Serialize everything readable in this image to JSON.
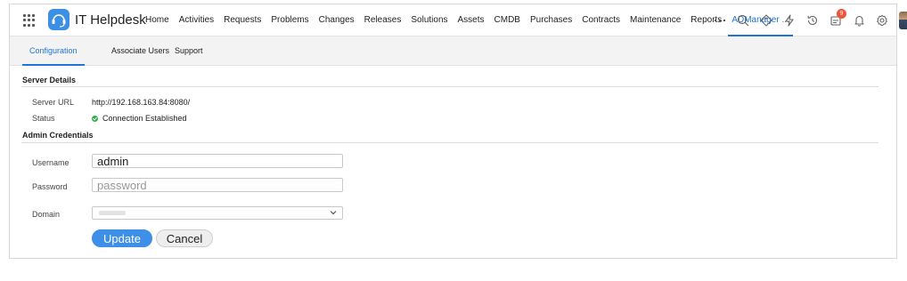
{
  "app": {
    "title": "IT Helpdesk"
  },
  "nav": {
    "items": [
      "Home",
      "Activities",
      "Requests",
      "Problems",
      "Changes",
      "Releases",
      "Solutions",
      "Assets",
      "CMDB",
      "Purchases",
      "Contracts",
      "Maintenance",
      "Reports",
      "ADManager ..."
    ],
    "active": "ADManager ..."
  },
  "header_icons": {
    "more": "more-icon",
    "search": "search-icon",
    "tag": "tag-icon",
    "quick_actions": "lightning-icon",
    "history": "history-icon",
    "requests": "requests-icon",
    "notifications": "bell-icon",
    "settings": "gear-icon",
    "notification_count": "9"
  },
  "tabs": {
    "items": [
      "Configuration",
      "Associate Users",
      "Support"
    ],
    "active": "Configuration"
  },
  "server_details": {
    "title": "Server Details",
    "server_url_label": "Server URL",
    "server_url_value": "http://192.168.163.84:8080/",
    "status_label": "Status",
    "status_value": "Connection Established"
  },
  "admin_credentials": {
    "title": "Admin Credentials",
    "username_label": "Username",
    "username_value": "admin",
    "password_label": "Password",
    "password_placeholder": "password",
    "domain_label": "Domain"
  },
  "actions": {
    "update": "Update",
    "cancel": "Cancel"
  },
  "colors": {
    "accent": "#1e74d6",
    "primary_button": "#3d8fe8",
    "status_ok": "#2fae48",
    "badge": "#f0533a"
  }
}
